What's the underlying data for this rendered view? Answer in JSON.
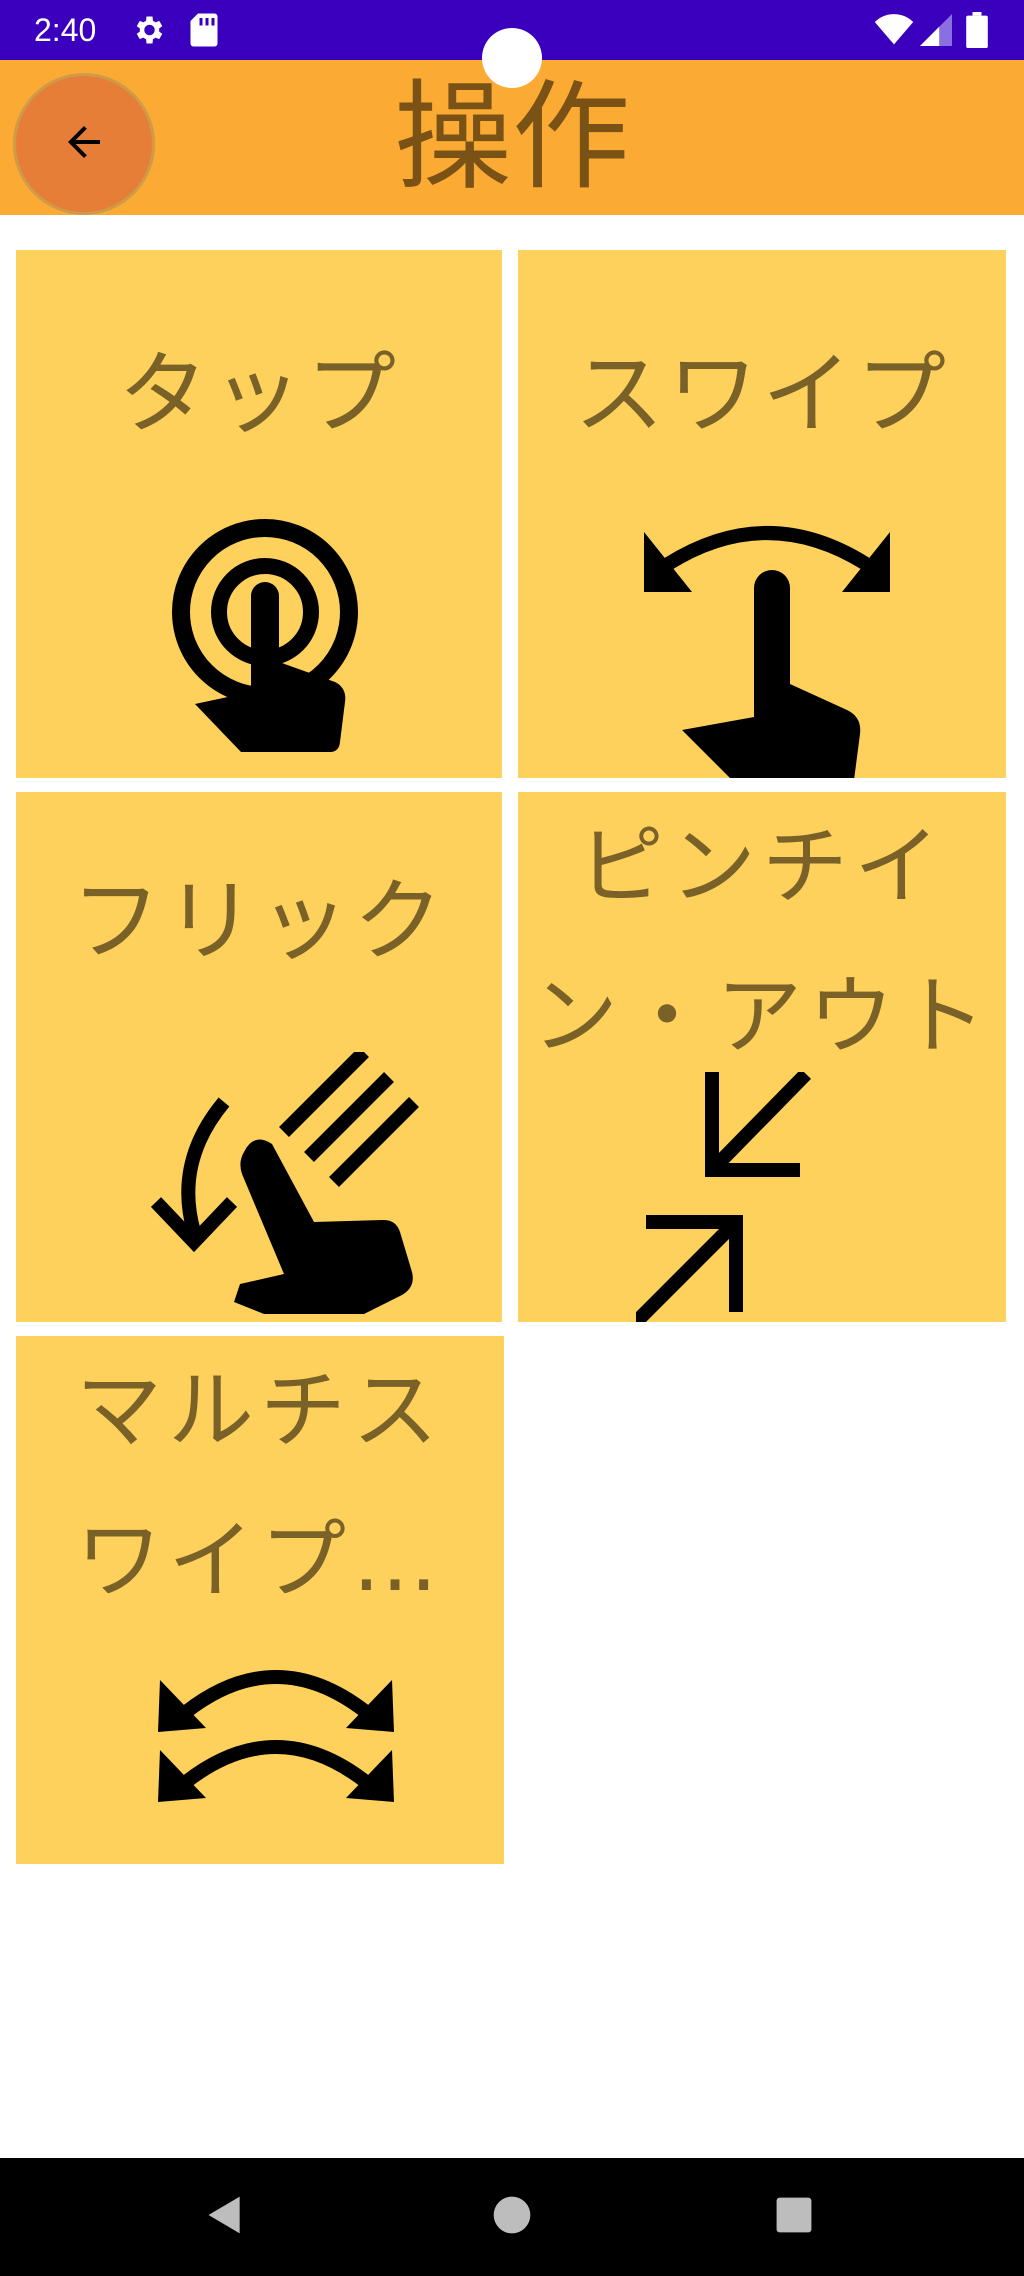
{
  "status_bar": {
    "time": "2:40",
    "icons": [
      "gear-icon",
      "sd-card-icon",
      "wifi-icon",
      "signal-icon",
      "battery-icon"
    ]
  },
  "app_bar": {
    "title": "操作",
    "back_icon": "arrow-left-icon",
    "background": "#fbaa33",
    "back_button_color": "#e67e38"
  },
  "tiles": [
    {
      "label": "タップ",
      "icon": "tap-icon"
    },
    {
      "label": "スワイプ",
      "icon": "swipe-icon"
    },
    {
      "label": "フリック",
      "icon": "flick-icon"
    },
    {
      "label": "ピンチイン・アウト",
      "icon": "pinch-icon"
    },
    {
      "label": "マルチスワイプ…",
      "icon": "multi-swipe-icon"
    }
  ],
  "tile_color": "#fdd15c",
  "nav_bar": {
    "back": "back-triangle-icon",
    "home": "home-circle-icon",
    "recents": "recents-square-icon"
  }
}
